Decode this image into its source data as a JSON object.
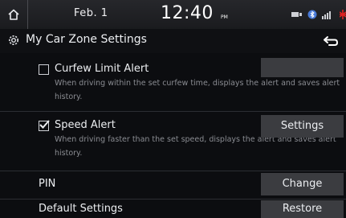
{
  "status_bar": {
    "date": "Feb.  1",
    "time": "12:40",
    "ampm": "PM"
  },
  "header": {
    "title": "My Car Zone Settings"
  },
  "rows": {
    "curfew": {
      "label": "Curfew Limit Alert",
      "description": "When driving within the set curfew time, displays the alert and saves alert history.",
      "checked": false
    },
    "speed": {
      "label": "Speed Alert",
      "description": "When driving faster than the set speed, displays the alert and saves alert history.",
      "checked": true,
      "button_label": "Settings"
    },
    "pin": {
      "label": "PIN",
      "button_label": "Change"
    },
    "default": {
      "label": "Default Settings",
      "button_label": "Restore"
    }
  },
  "colors": {
    "background": "#0c0d10",
    "button": "#3b3c40",
    "battery_red": "#e02020"
  }
}
